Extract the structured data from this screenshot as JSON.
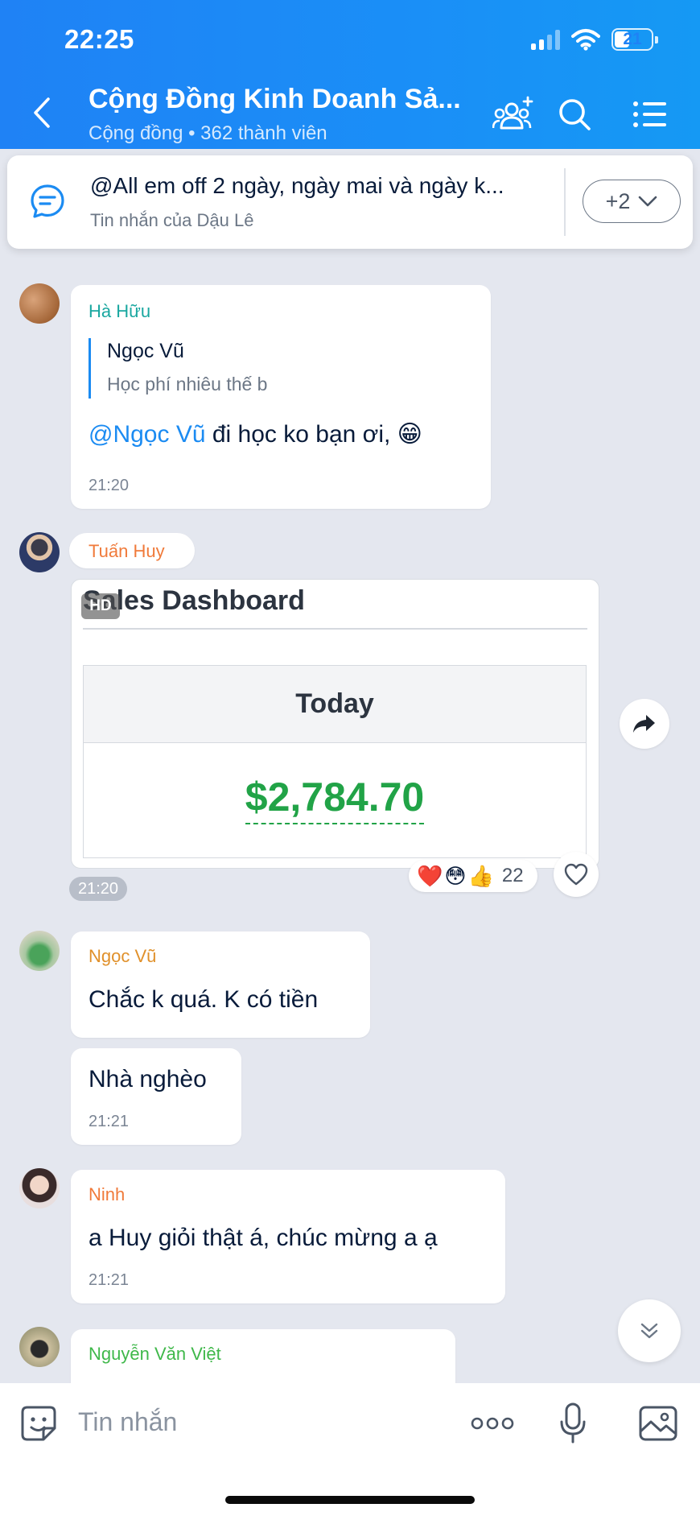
{
  "status_bar": {
    "time": "22:25",
    "battery": "21"
  },
  "header": {
    "title": "Cộng Đồng Kinh Doanh Sả...",
    "subtitle": "Cộng đồng • 362 thành viên"
  },
  "pinned": {
    "text": "@All em off 2 ngày, ngày mai và ngày k...",
    "sub": "Tin nhắn của Dậu Lê",
    "more_label": "+2"
  },
  "messages": [
    {
      "sender": "Hà Hữu",
      "sender_color": "#1aa7a0",
      "quote": {
        "name": "Ngọc Vũ",
        "text": "Học phí nhiêu thế b"
      },
      "mention": "@Ngọc Vũ",
      "text": " đi học ko bạn ơi, ",
      "emoji": "😁",
      "time": "21:20"
    },
    {
      "sender": "Tuấn Huy",
      "sender_color": "#f07a3a",
      "image": {
        "badge": "HD",
        "heading": "Sales Dashboard",
        "column": "Today",
        "value": "$2,784.70"
      },
      "time": "21:20",
      "reactions": {
        "emojis": [
          "❤️",
          "😳",
          "👍"
        ],
        "count": "22"
      }
    },
    {
      "sender": "Ngọc Vũ",
      "sender_color": "#e0902a",
      "texts": [
        "Chắc k quá. K có tiền",
        "Nhà nghèo"
      ],
      "time": "21:21"
    },
    {
      "sender": "Ninh",
      "sender_color": "#f07a3a",
      "text": "a Huy giỏi thật á, chúc mừng a ạ",
      "time": "21:21"
    },
    {
      "sender": "Nguyễn Văn Việt",
      "sender_color": "#3fb84a"
    }
  ],
  "input": {
    "placeholder": "Tin nhắn"
  },
  "colors": {
    "header": "#1f82f5",
    "accent": "#1b8bf2",
    "money": "#21a347",
    "background": "#e4e7ef"
  },
  "icons": [
    "back-icon",
    "add-member-icon",
    "search-icon",
    "menu-icon",
    "pinned-chat-icon",
    "chevron-down-icon",
    "share-icon",
    "heart-icon",
    "scroll-down-icon",
    "sticker-icon",
    "more-icon",
    "mic-icon",
    "image-icon"
  ]
}
